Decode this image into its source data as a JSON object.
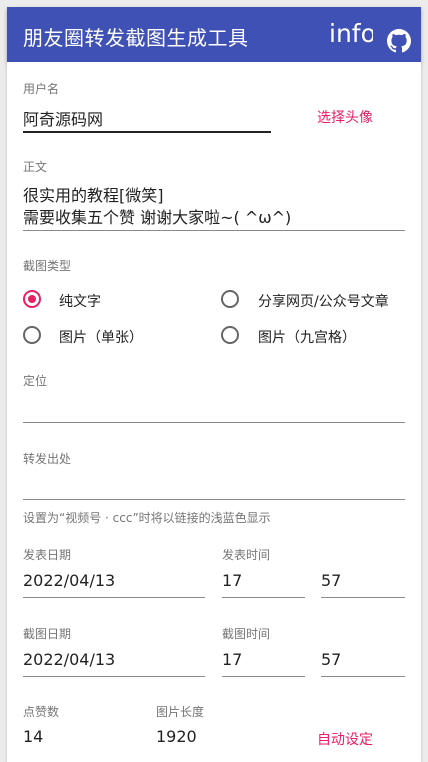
{
  "app": {
    "title": "朋友圈转发截图生成工具",
    "info_label": "info",
    "github_icon": "github-icon"
  },
  "form": {
    "username": {
      "label": "用户名",
      "value": "阿奇源码网"
    },
    "choose_avatar": "选择头像",
    "body_text": {
      "label": "正文",
      "line1": "很实用的教程[微笑]",
      "line2": "需要收集五个赞 谢谢大家啦~(   ^ω^)"
    },
    "screenshot_type": {
      "label": "截图类型",
      "options": [
        "纯文字",
        "分享网页/公众号文章",
        "图片（单张）",
        "图片（九宫格）"
      ],
      "selected": "纯文字"
    },
    "location": {
      "label": "定位",
      "value": ""
    },
    "repost_source": {
      "label": "转发出处",
      "value": "",
      "hint": "设置为“视频号 · ccc”时将以链接的浅蓝色显示"
    },
    "publish_date": {
      "label": "发表日期",
      "value": "2022/04/13"
    },
    "publish_time": {
      "label": "发表时间",
      "hour": "17",
      "minute": "57"
    },
    "screenshot_date": {
      "label": "截图日期",
      "value": "2022/04/13"
    },
    "screenshot_time": {
      "label": "截图时间",
      "hour": "17",
      "minute": "57"
    },
    "likes": {
      "label": "点赞数",
      "value": "14"
    },
    "image_length": {
      "label": "图片长度",
      "value": "1920"
    },
    "auto_set": "自动设定"
  },
  "colors": {
    "primary": "#3f51b5",
    "accent": "#e91e63"
  }
}
